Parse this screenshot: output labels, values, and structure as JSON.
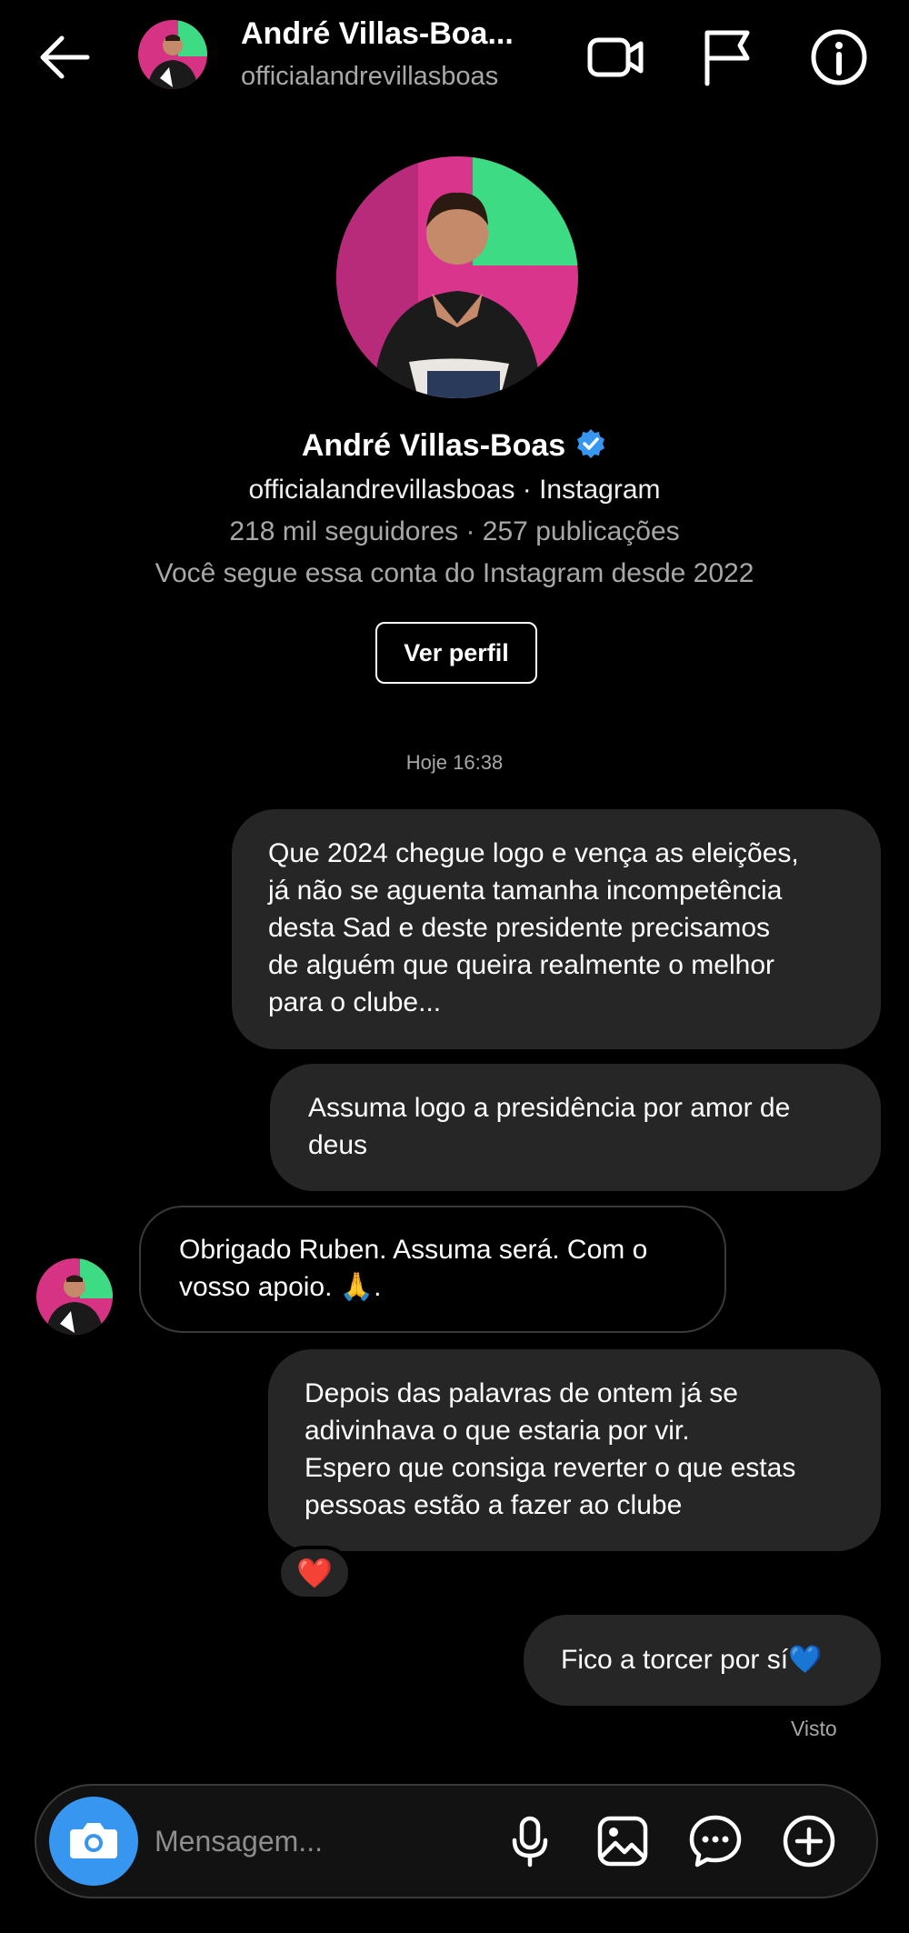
{
  "header": {
    "name": "André Villas-Boa...",
    "handle": "officialandrevillasboas"
  },
  "profile": {
    "name": "André Villas-Boas",
    "handle_line": "officialandrevillasboas · Instagram",
    "stats_line": "218 mil seguidores · 257 publicações",
    "follow_since": "Você segue essa conta do Instagram desde 2022",
    "view_profile_label": "Ver perfil"
  },
  "timestamp": "Hoje 16:38",
  "messages": [
    {
      "direction": "outgoing",
      "text": "Que 2024 chegue logo e vença as eleições,\njá não se aguenta tamanha incompetência\ndesta Sad e deste presidente precisamos\nde alguém que queira realmente o melhor\npara o clube..."
    },
    {
      "direction": "outgoing",
      "text": "Assuma logo a presidência por amor de\ndeus"
    },
    {
      "direction": "incoming",
      "text": "Obrigado Ruben. Assuma será. Com o\nvosso apoio. 🙏."
    },
    {
      "direction": "outgoing",
      "text": "Depois das palavras de ontem já se\nadivinhava o que estaria por vir.\nEspero que consiga reverter o que estas\npessoas estão a fazer ao clube",
      "reaction": "❤️"
    },
    {
      "direction": "outgoing",
      "text": "Fico a torcer por sí💙"
    }
  ],
  "seen_label": "Visto",
  "composer": {
    "placeholder": "Mensagem..."
  },
  "icons": [
    "back-arrow-icon",
    "video-call-icon",
    "flag-icon",
    "info-icon",
    "verified-badge-icon",
    "camera-icon",
    "microphone-icon",
    "gallery-icon",
    "sticker-icon",
    "plus-icon"
  ],
  "colors": {
    "background": "#000000",
    "bubble": "#262626",
    "accent": "#3797f0",
    "muted_text": "#a8a8a8"
  }
}
